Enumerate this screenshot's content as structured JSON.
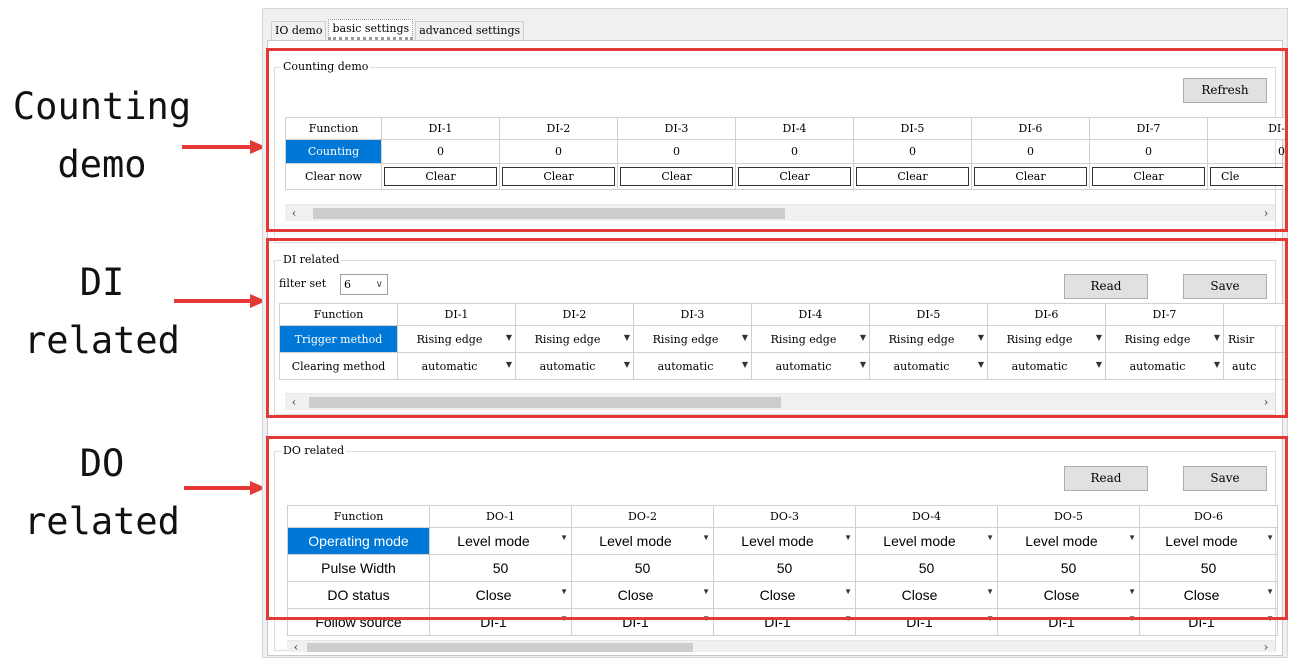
{
  "annotations": {
    "counting_label": "Counting\ndemo",
    "di_label": "DI\nrelated",
    "do_label": "DO\nrelated"
  },
  "colors": {
    "annotation_red": "#e53935",
    "selection_blue": "#0078d7"
  },
  "tabs": [
    "IO demo",
    "basic settings",
    "advanced settings"
  ],
  "active_tab": "basic settings",
  "counting": {
    "title": "Counting demo",
    "refresh_label": "Refresh",
    "headers": [
      "Function",
      "DI-1",
      "DI-2",
      "DI-3",
      "DI-4",
      "DI-5",
      "DI-6",
      "DI-7",
      "DI-"
    ],
    "counting_row": {
      "label": "Counting",
      "values": [
        "0",
        "0",
        "0",
        "0",
        "0",
        "0",
        "0",
        "0"
      ]
    },
    "clear_row": {
      "label": "Clear now",
      "values": [
        "Clear",
        "Clear",
        "Clear",
        "Clear",
        "Clear",
        "Clear",
        "Clear",
        "Cle"
      ]
    }
  },
  "di": {
    "title": "DI related",
    "filter_label": "filter set",
    "filter_value": "6",
    "read_label": "Read",
    "save_label": "Save",
    "headers": [
      "Function",
      "DI-1",
      "DI-2",
      "DI-3",
      "DI-4",
      "DI-5",
      "DI-6",
      "DI-7",
      ""
    ],
    "trigger_row": {
      "label": "Trigger method",
      "values": [
        "Rising edge",
        "Rising edge",
        "Rising edge",
        "Rising edge",
        "Rising edge",
        "Rising edge",
        "Rising edge",
        "Risir"
      ]
    },
    "clearing_row": {
      "label": "Clearing method",
      "values": [
        "automatic",
        "automatic",
        "automatic",
        "automatic",
        "automatic",
        "automatic",
        "automatic",
        "autc"
      ]
    }
  },
  "do": {
    "title": "DO related",
    "read_label": "Read",
    "save_label": "Save",
    "headers": [
      "Function",
      "DO-1",
      "DO-2",
      "DO-3",
      "DO-4",
      "DO-5",
      "DO-6"
    ],
    "operating_row": {
      "label": "Operating mode",
      "values": [
        "Level mode",
        "Level mode",
        "Level mode",
        "Level mode",
        "Level mode",
        "Level mode"
      ]
    },
    "pulse_row": {
      "label": "Pulse Width",
      "values": [
        "50",
        "50",
        "50",
        "50",
        "50",
        "50"
      ]
    },
    "status_row": {
      "label": "DO status",
      "values": [
        "Close",
        "Close",
        "Close",
        "Close",
        "Close",
        "Close"
      ]
    },
    "follow_row": {
      "label": "Follow source",
      "values": [
        "DI-1",
        "DI-1",
        "DI-1",
        "DI-1",
        "DI-1",
        "DI-1"
      ]
    }
  },
  "icons": {
    "scroll_left": "chevron-left-icon",
    "scroll_right": "chevron-right-icon",
    "dropdown": "caret-down-icon"
  }
}
